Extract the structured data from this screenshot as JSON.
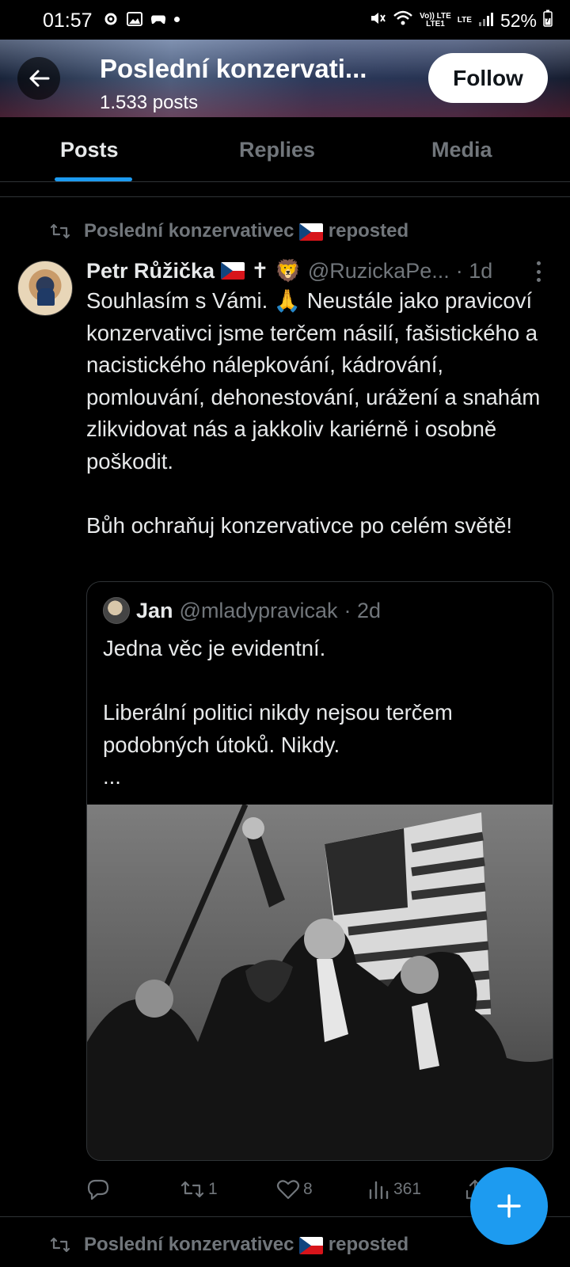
{
  "status_bar": {
    "time": "01:57",
    "battery": "52%",
    "volte_top": "Vo)) LTE",
    "volte_bottom": "LTE1",
    "lte": "LTE"
  },
  "header": {
    "title": "Poslední konzervati...",
    "posts_count": "1.533 posts",
    "follow_label": "Follow"
  },
  "tabs": [
    {
      "label": "Posts",
      "active": true
    },
    {
      "label": "Replies",
      "active": false
    },
    {
      "label": "Media",
      "active": false
    }
  ],
  "repost": {
    "who": "Poslední konzervativec",
    "suffix": "reposted"
  },
  "tweet": {
    "name": "Petr Růžička",
    "name_emoji": "✝ 🦁",
    "handle": "@RuzickaPe...",
    "time": "· 1d",
    "text": "Souhlasím s Vámi. 🙏 Neustále jako pravicoví konzervativci jsme terčem násilí, fašistického a nacistického nálepkování, kádrování, pomlouvání, dehonestování, urážení a snahám zlikvidovat nás a jakkoliv kariérně i osobně poškodit.\n\nBůh ochraňuj konzervativce po celém světě!",
    "quote": {
      "name": "Jan",
      "handle": "@mladypravicak",
      "time": "· 2d",
      "text": "Jedna věc je evidentní.\n\nLiberální politici nikdy nejsou terčem podobných útoků. Nikdy.\n..."
    },
    "actions": {
      "replies": "",
      "reposts": "1",
      "likes": "8",
      "views": "361"
    }
  },
  "next_repost": {
    "who": "Poslední konzervativec",
    "suffix": "reposted"
  },
  "colors": {
    "accent": "#1d9bf0",
    "muted": "#71767b",
    "text": "#e7e9ea",
    "background": "#000000",
    "border": "#2f3336"
  }
}
